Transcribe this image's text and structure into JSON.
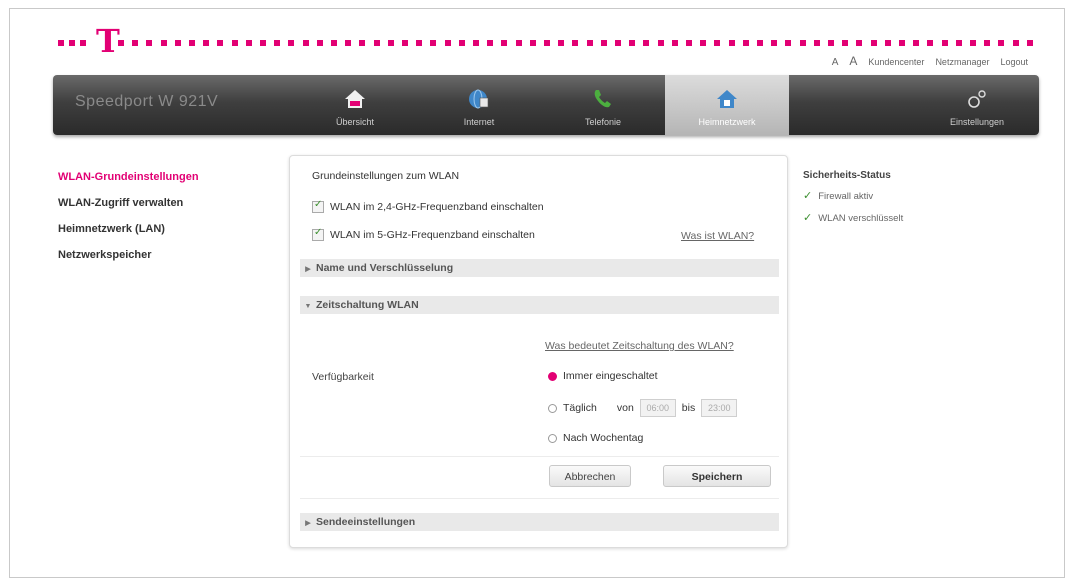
{
  "header": {
    "links": [
      "A",
      "A",
      "Kundencenter",
      "Netzmanager",
      "Logout"
    ]
  },
  "navbar": {
    "brand": "Speedport W 921V",
    "tabs": [
      {
        "label": "Übersicht",
        "icon": "home-icon"
      },
      {
        "label": "Internet",
        "icon": "globe-icon"
      },
      {
        "label": "Telefonie",
        "icon": "phone-icon"
      },
      {
        "label": "Heimnetzwerk",
        "icon": "home-network-icon",
        "active": true
      }
    ],
    "settings": {
      "label": "Einstellungen",
      "icon": "gear-icon"
    }
  },
  "sidenav": {
    "items": [
      {
        "label": "WLAN-Grundeinstellungen",
        "active": true
      },
      {
        "label": "WLAN-Zugriff verwalten"
      },
      {
        "label": "Heimnetzwerk (LAN)"
      },
      {
        "label": "Netzwerkspeicher"
      }
    ]
  },
  "panel": {
    "title": "Grundeinstellungen zum WLAN",
    "checkbox_24": "WLAN im 2,4-GHz-Frequenzband einschalten",
    "checkbox_5": "WLAN im 5-GHz-Frequenzband einschalten",
    "help_wlan": "Was ist WLAN?",
    "sections": {
      "name": "Name und Verschlüsselung",
      "timer": "Zeitschaltung WLAN",
      "send": "Sendeeinstellungen"
    },
    "help_timer": "Was bedeutet Zeitschaltung des WLAN?",
    "availability_label": "Verfügbarkeit",
    "radio_always": "Immer eingeschaltet",
    "radio_daily": "Täglich",
    "from_label": "von",
    "from_value": "06:00",
    "to_label": "bis",
    "to_value": "23:00",
    "radio_weekday": "Nach Wochentag",
    "cancel": "Abbrechen",
    "save": "Speichern"
  },
  "status": {
    "title": "Sicherheits-Status",
    "items": [
      "Firewall aktiv",
      "WLAN verschlüsselt"
    ]
  },
  "colors": {
    "brand": "#e20074",
    "check": "#3c8f2f"
  }
}
